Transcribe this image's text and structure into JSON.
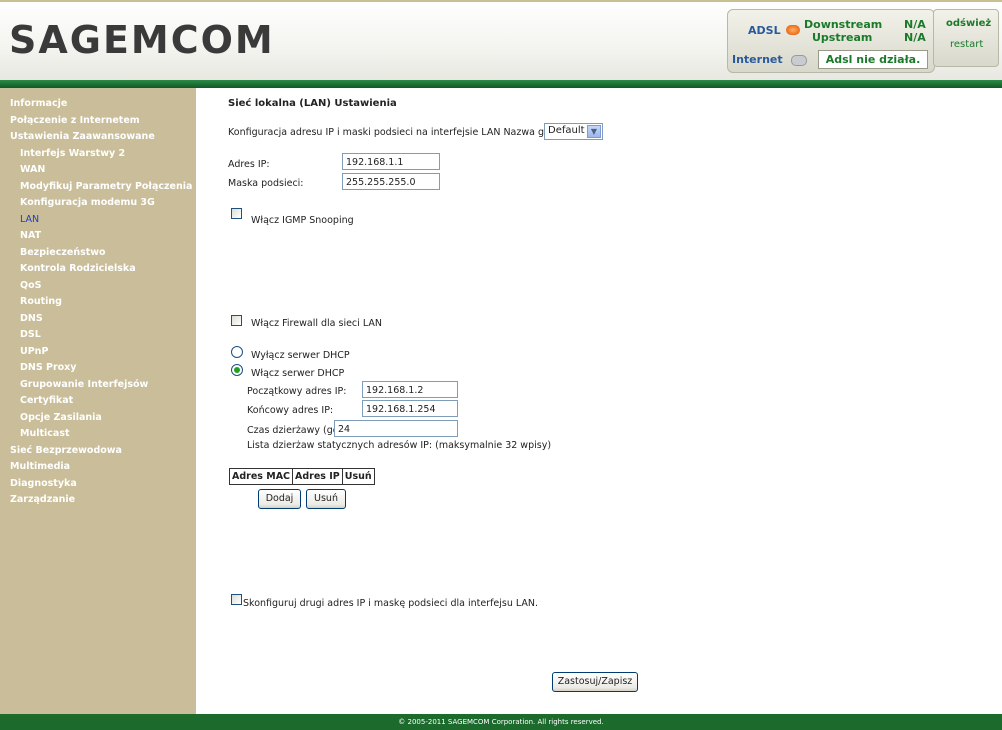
{
  "header": {
    "logo": "SAGEMCOM",
    "status": {
      "adsl_label": "ADSL",
      "downstream_label": "Downstream",
      "upstream_label": "Upstream",
      "downstream_value": "N/A",
      "upstream_value": "N/A",
      "internet_label": "Internet",
      "message": "Adsl nie działa.",
      "refresh_label": "odśwież",
      "restart_label": "restart"
    }
  },
  "sidebar": {
    "items": [
      {
        "label": "Informacje"
      },
      {
        "label": "Połączenie z Internetem"
      },
      {
        "label": "Ustawienia Zaawansowane"
      },
      {
        "label": "Interfejs Warstwy 2"
      },
      {
        "label": "WAN"
      },
      {
        "label": "Modyfikuj Parametry Połączenia"
      },
      {
        "label": "Konfiguracja modemu 3G"
      },
      {
        "label": "LAN"
      },
      {
        "label": "NAT"
      },
      {
        "label": "Bezpieczeństwo"
      },
      {
        "label": "Kontrola Rodzicielska"
      },
      {
        "label": "QoS"
      },
      {
        "label": "Routing"
      },
      {
        "label": "DNS"
      },
      {
        "label": "DSL"
      },
      {
        "label": "UPnP"
      },
      {
        "label": "DNS Proxy"
      },
      {
        "label": "Grupowanie Interfejsów"
      },
      {
        "label": "Certyfikat"
      },
      {
        "label": "Opcje Zasilania"
      },
      {
        "label": "Multicast"
      },
      {
        "label": "Sieć Bezprzewodowa"
      },
      {
        "label": "Multimedia"
      },
      {
        "label": "Diagnostyka"
      },
      {
        "label": "Zarządzanie"
      }
    ]
  },
  "main": {
    "title": "Sieć lokalna (LAN) Ustawienia",
    "intro": "Konfiguracja adresu IP i maski podsieci na interfejsie LAN  Nazwa grupy",
    "group_select": "Default",
    "ip_label": "Adres IP:",
    "ip_value": "192.168.1.1",
    "mask_label": "Maska podsieci:",
    "mask_value": "255.255.255.0",
    "igmp_label": "Włącz IGMP Snooping",
    "firewall_label": "Włącz Firewall dla sieci LAN",
    "dhcp_off_label": "Wyłącz serwer DHCP",
    "dhcp_on_label": "Włącz serwer DHCP",
    "start_ip_label": "Początkowy adres IP:",
    "start_ip_value": "192.168.1.2",
    "end_ip_label": "Końcowy adres IP:",
    "end_ip_value": "192.168.1.254",
    "lease_label": "Czas dzierżawy (godziny):",
    "lease_value": "24",
    "static_list_label": "Lista dzierżaw statycznych adresów IP: (maksymalnie 32 wpisy)",
    "table_headers": [
      "Adres MAC",
      "Adres IP",
      "Usuń"
    ],
    "add_button": "Dodaj",
    "remove_button": "Usuń",
    "second_ip_label": "Skonfiguruj drugi adres IP i maskę podsieci dla interfejsu LAN.",
    "apply_button": "Zastosuj/Zapisz"
  },
  "footer": {
    "copyright": "© 2005-2011 SAGEMCOM Corporation. All rights reserved."
  }
}
